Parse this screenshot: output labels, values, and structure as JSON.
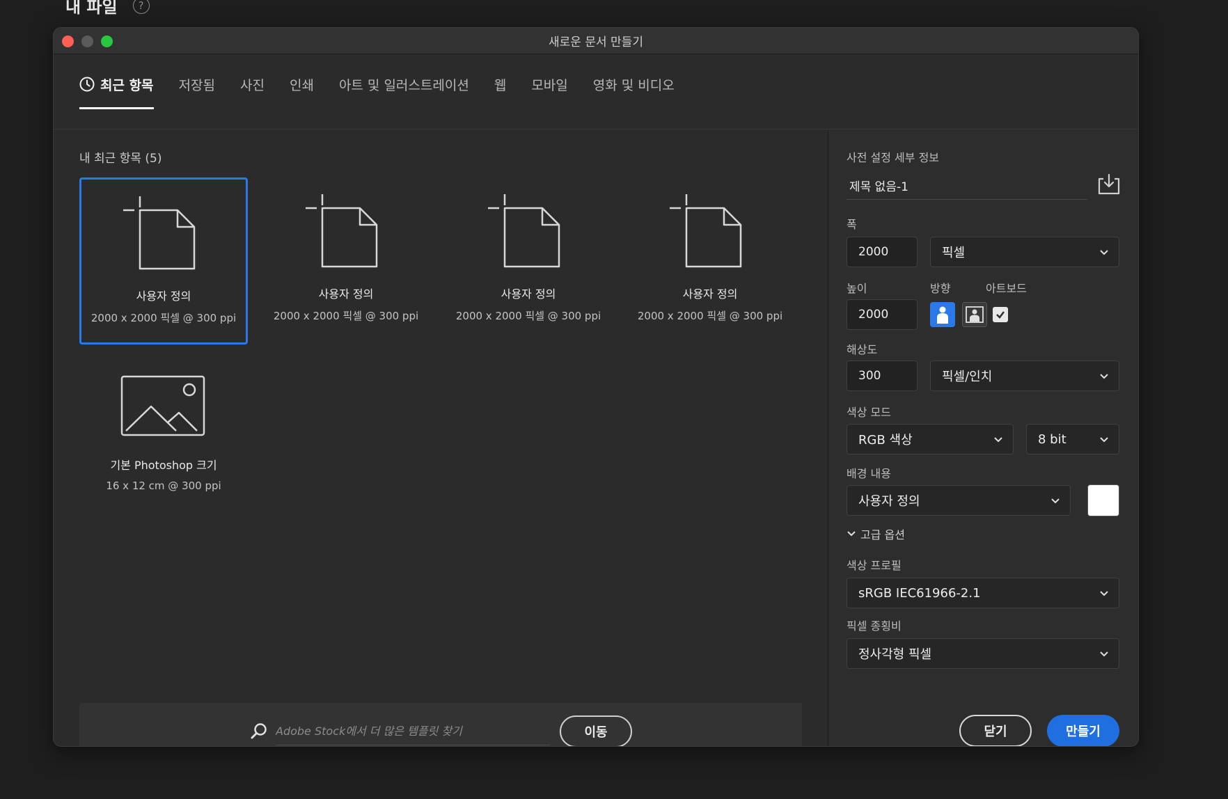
{
  "page": {
    "heading": "내 파일",
    "help_glyph": "?"
  },
  "dialog": {
    "title": "새로운 문서 만들기"
  },
  "tabs": [
    {
      "label": "최근 항목",
      "active": true,
      "icon": "clock-icon"
    },
    {
      "label": "저장됨"
    },
    {
      "label": "사진"
    },
    {
      "label": "인쇄"
    },
    {
      "label": "아트 및 일러스트레이션"
    },
    {
      "label": "웹"
    },
    {
      "label": "모바일"
    },
    {
      "label": "영화 및 비디오"
    }
  ],
  "recent": {
    "title": "내 최근 항목 (5)",
    "items": [
      {
        "name": "사용자 정의",
        "info": "2000 x 2000 픽셀 @ 300 ppi",
        "icon": "blank-document-icon",
        "selected": true
      },
      {
        "name": "사용자 정의",
        "info": "2000 x 2000 픽셀 @ 300 ppi",
        "icon": "blank-document-icon"
      },
      {
        "name": "사용자 정의",
        "info": "2000 x 2000 픽셀 @ 300 ppi",
        "icon": "blank-document-icon"
      },
      {
        "name": "사용자 정의",
        "info": "2000 x 2000 픽셀 @ 300 ppi",
        "icon": "blank-document-icon"
      },
      {
        "name": "기본 Photoshop 크기",
        "info": "16 x 12 cm @ 300 ppi",
        "icon": "image-icon"
      }
    ]
  },
  "search": {
    "placeholder": "Adobe Stock에서 더 많은 템플릿 찾기",
    "button_label": "이동"
  },
  "preset_details": {
    "title": "사전 설정 세부 정보",
    "doc_name": "제목 없음-1",
    "width_label": "폭",
    "width_value": "2000",
    "width_unit": "픽셀",
    "height_label": "높이",
    "height_value": "2000",
    "orientation_label": "방향",
    "orientation": "portrait",
    "artboard_label": "아트보드",
    "artboard_checked": true,
    "resolution_label": "해상도",
    "resolution_value": "300",
    "resolution_unit": "픽셀/인치",
    "color_mode_label": "색상 모드",
    "color_mode": "RGB 색상",
    "bit_depth": "8 bit",
    "background_label": "배경 내용",
    "background": "사용자 정의",
    "background_color": "#ffffff",
    "advanced_label": "고급 옵션",
    "color_profile_label": "색상 프로필",
    "color_profile": "sRGB IEC61966-2.1",
    "pixel_aspect_label": "픽셀 종횡비",
    "pixel_aspect": "정사각형 픽셀"
  },
  "buttons": {
    "close": "닫기",
    "create": "만들기"
  },
  "colors": {
    "accent": "#1f6fe0",
    "selection": "#2b79e8",
    "dialog_bg": "#2b2b2b"
  }
}
